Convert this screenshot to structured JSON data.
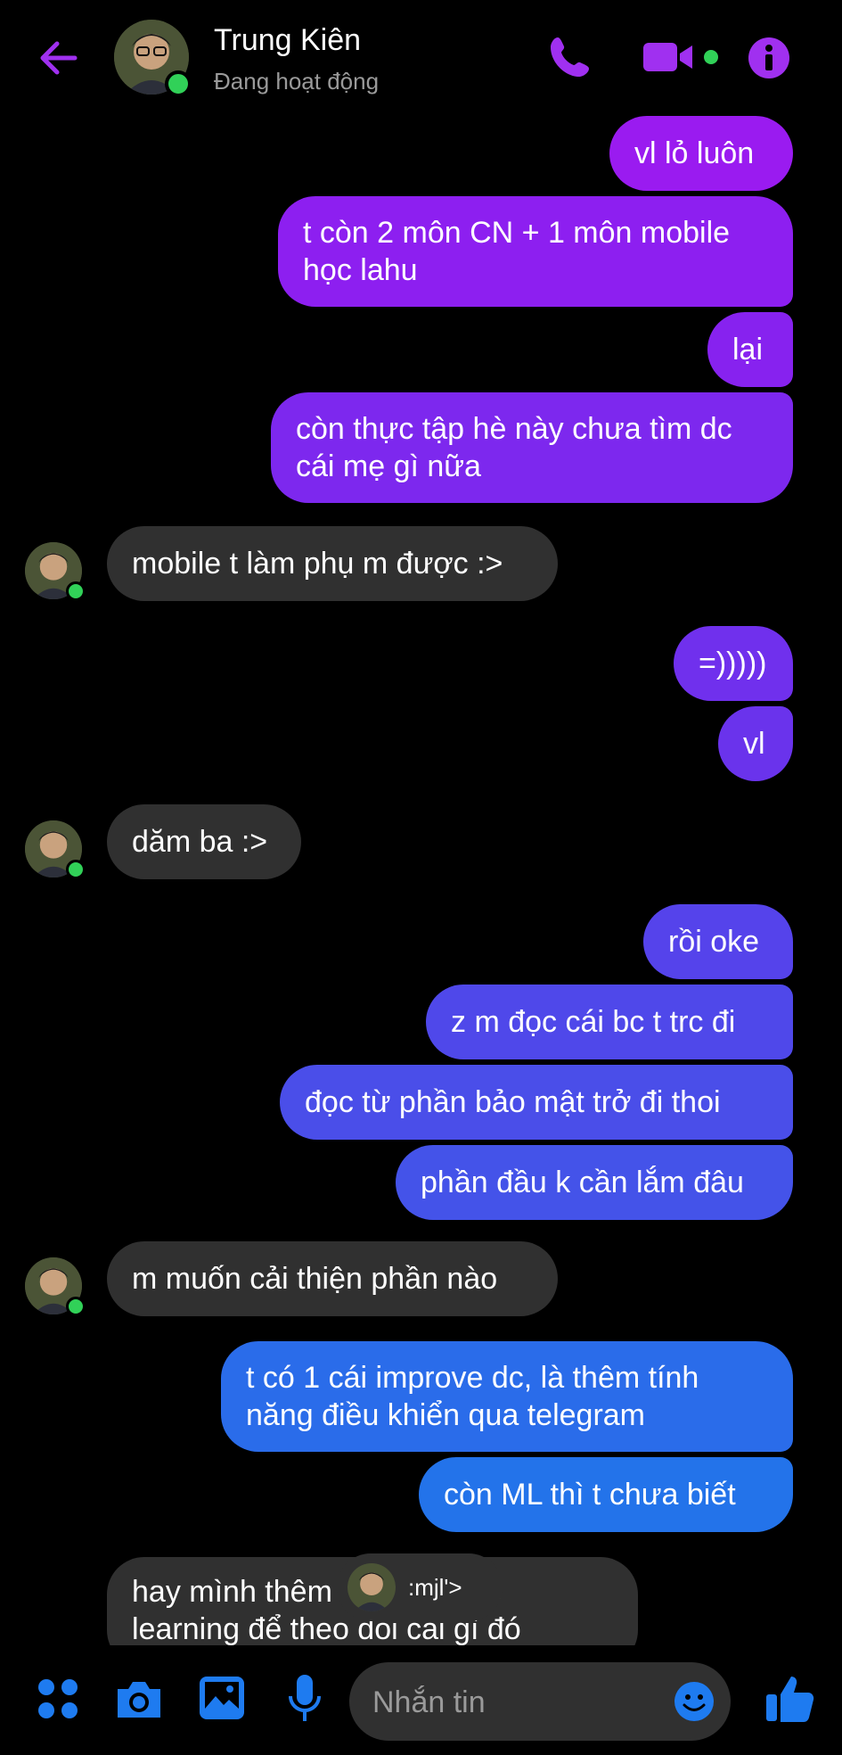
{
  "header": {
    "name": "Trung Kiên",
    "status": "Đang hoạt động"
  },
  "colors": {
    "accent": "#a030f0",
    "online": "#31d158",
    "received_bubble": "#303030",
    "composer_icons": "#1e7bf0"
  },
  "messages": [
    {
      "side": "sent",
      "text": "vl lỏ luôn",
      "color": "#9a1bf0"
    },
    {
      "side": "sent",
      "text": "t còn 2 môn CN + 1 môn mobile\nhọc lahu",
      "color": "#8d1ff0"
    },
    {
      "side": "sent",
      "text": "lại",
      "color": "#8722ef"
    },
    {
      "side": "sent",
      "text": "còn thực tập hè này chưa tìm dc\ncái mẹ gì nữa",
      "color": "#7d28ee"
    },
    {
      "side": "received",
      "text": "mobile t làm phụ m được :>"
    },
    {
      "side": "sent",
      "text": "=)))))",
      "color": "#7030ed"
    },
    {
      "side": "sent",
      "text": "vl",
      "color": "#6a33ec"
    },
    {
      "side": "received",
      "text": "dăm ba :>"
    },
    {
      "side": "sent",
      "text": "rồi oke",
      "color": "#5543eb"
    },
    {
      "side": "sent",
      "text": "z m đọc cái bc t trc đi",
      "color": "#4f48ea"
    },
    {
      "side": "sent",
      "text": "đọc từ phần bảo mật trở đi thoi",
      "color": "#4a4ee9"
    },
    {
      "side": "sent",
      "text": "phần đầu k cần lắm đâu",
      "color": "#4453e9"
    },
    {
      "side": "received",
      "text": "m muốn cải thiện phần nào"
    },
    {
      "side": "sent",
      "text": "t có 1 cái improve dc, là thêm tính\nnăng điều khiển qua telegram",
      "color": "#2a6cea"
    },
    {
      "side": "sent",
      "text": "còn ML thì t chưa biết",
      "color": "#2373ea"
    },
    {
      "side": "received",
      "text": "hay mình thêm cái machine\nlearning để theo dõi cái gì đó"
    }
  ],
  "reaction": {
    "text": ":mjl'>"
  },
  "composer": {
    "placeholder": "Nhắn tin"
  }
}
